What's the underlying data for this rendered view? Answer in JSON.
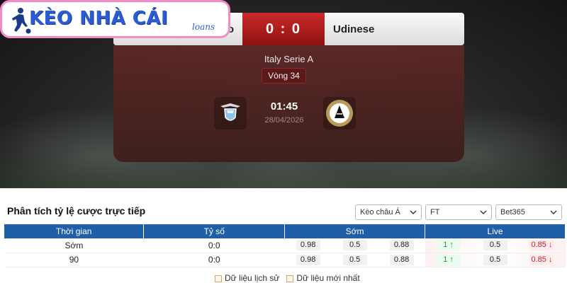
{
  "brand": {
    "title": "KÈO NHÀ CÁI",
    "subtitle": "loans",
    "colors": {
      "border": "#f28cc8",
      "text": "#2b5cd6"
    }
  },
  "match": {
    "home_team_partial": "o",
    "score": "0 : 0",
    "away_team": "Udinese",
    "league": "Italy Serie A",
    "round": "Vòng 34",
    "time": "01:45",
    "date": "28/04/2026",
    "home_logo_icon": "lazio-eagle-crest-icon",
    "away_logo_icon": "udinese-zebra-crest-icon"
  },
  "analysis": {
    "title": "Phân tích tỷ lệ cược trực tiếp",
    "filters": [
      {
        "value": "Kèo châu Á"
      },
      {
        "value": "FT"
      },
      {
        "value": "Bet365"
      }
    ],
    "columns": [
      "Thời gian",
      "Tỷ số",
      "Sớm",
      "Live"
    ],
    "rows": [
      {
        "time": "Sớm",
        "score": "0:0",
        "early": [
          "0.98",
          "0.5",
          "0.88"
        ],
        "live": [
          "1",
          "0.5",
          "0.85"
        ]
      },
      {
        "time": "90",
        "score": "0:0",
        "early": [
          "0.98",
          "0.5",
          "0.88"
        ],
        "live": [
          "1",
          "0.5",
          "0.85"
        ]
      }
    ],
    "legend": [
      "Dữ liệu lịch sử",
      "Dữ liệu mới nhất"
    ]
  }
}
